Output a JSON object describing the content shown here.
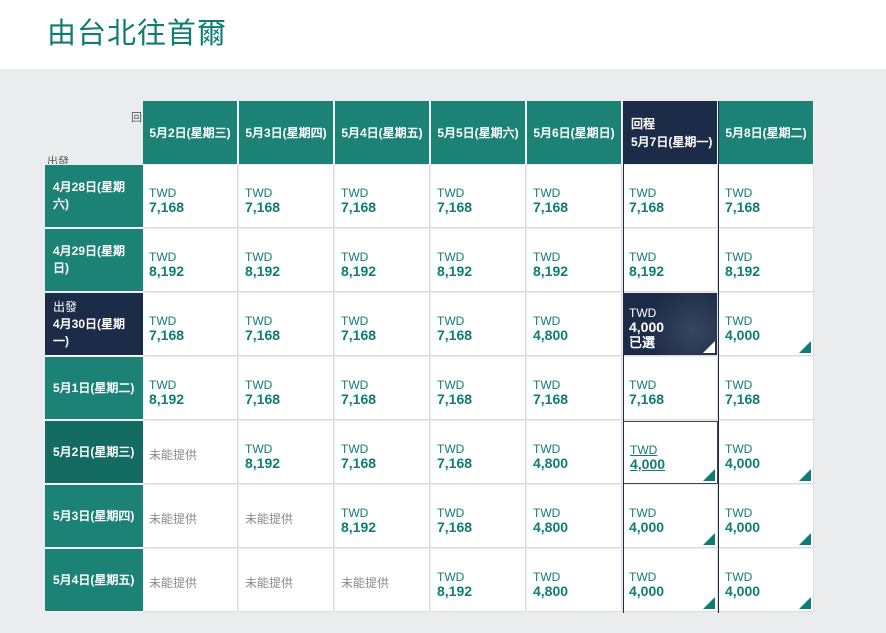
{
  "page_title": "由台北往首爾",
  "corner": {
    "return_label": "回",
    "depart_label": "出發"
  },
  "columns": [
    {
      "label": "5月2日(星期三)",
      "selected": false
    },
    {
      "label": "5月3日(星期四)",
      "selected": false
    },
    {
      "label": "5月4日(星期五)",
      "selected": false
    },
    {
      "label": "5月5日(星期六)",
      "selected": false
    },
    {
      "label": "5月6日(星期日)",
      "selected": false
    },
    {
      "prefix": "回程",
      "label": "5月7日(星期一)",
      "selected": true
    },
    {
      "label": "5月8日(星期二)",
      "selected": false
    }
  ],
  "rows": [
    {
      "label": "4月28日(星期六)",
      "selected": false,
      "cells": [
        "7,168",
        "7,168",
        "7,168",
        "7,168",
        "7,168",
        "7,168",
        "7,168"
      ]
    },
    {
      "label": "4月29日(星期日)",
      "selected": false,
      "cells": [
        "8,192",
        "8,192",
        "8,192",
        "8,192",
        "8,192",
        "8,192",
        "8,192"
      ]
    },
    {
      "prefix": "出發",
      "label": "4月30日(星期一)",
      "selected": true,
      "cells": [
        "7,168",
        "7,168",
        "7,168",
        "7,168",
        "4,800",
        "4,000",
        "4,000"
      ]
    },
    {
      "label": "5月1日(星期二)",
      "selected": false,
      "cells": [
        "8,192",
        "7,168",
        "7,168",
        "7,168",
        "7,168",
        "7,168",
        "7,168"
      ]
    },
    {
      "label": "5月2日(星期三)",
      "selected": false,
      "dark": true,
      "cells": [
        null,
        "8,192",
        "7,168",
        "7,168",
        "4,800",
        "4,000",
        "4,000"
      ]
    },
    {
      "label": "5月3日(星期四)",
      "selected": false,
      "cells": [
        null,
        null,
        "8,192",
        "7,168",
        "4,800",
        "4,000",
        "4,000"
      ]
    },
    {
      "label": "5月4日(星期五)",
      "selected": false,
      "cells": [
        null,
        null,
        null,
        "8,192",
        "4,800",
        "4,000",
        "4,000"
      ]
    }
  ],
  "currency": "TWD",
  "unavailable_text": "未能提供",
  "selected_text": "已選",
  "colors": {
    "teal": "#1b8275",
    "navy": "#1c2b47",
    "text_teal": "#0f7d72"
  }
}
